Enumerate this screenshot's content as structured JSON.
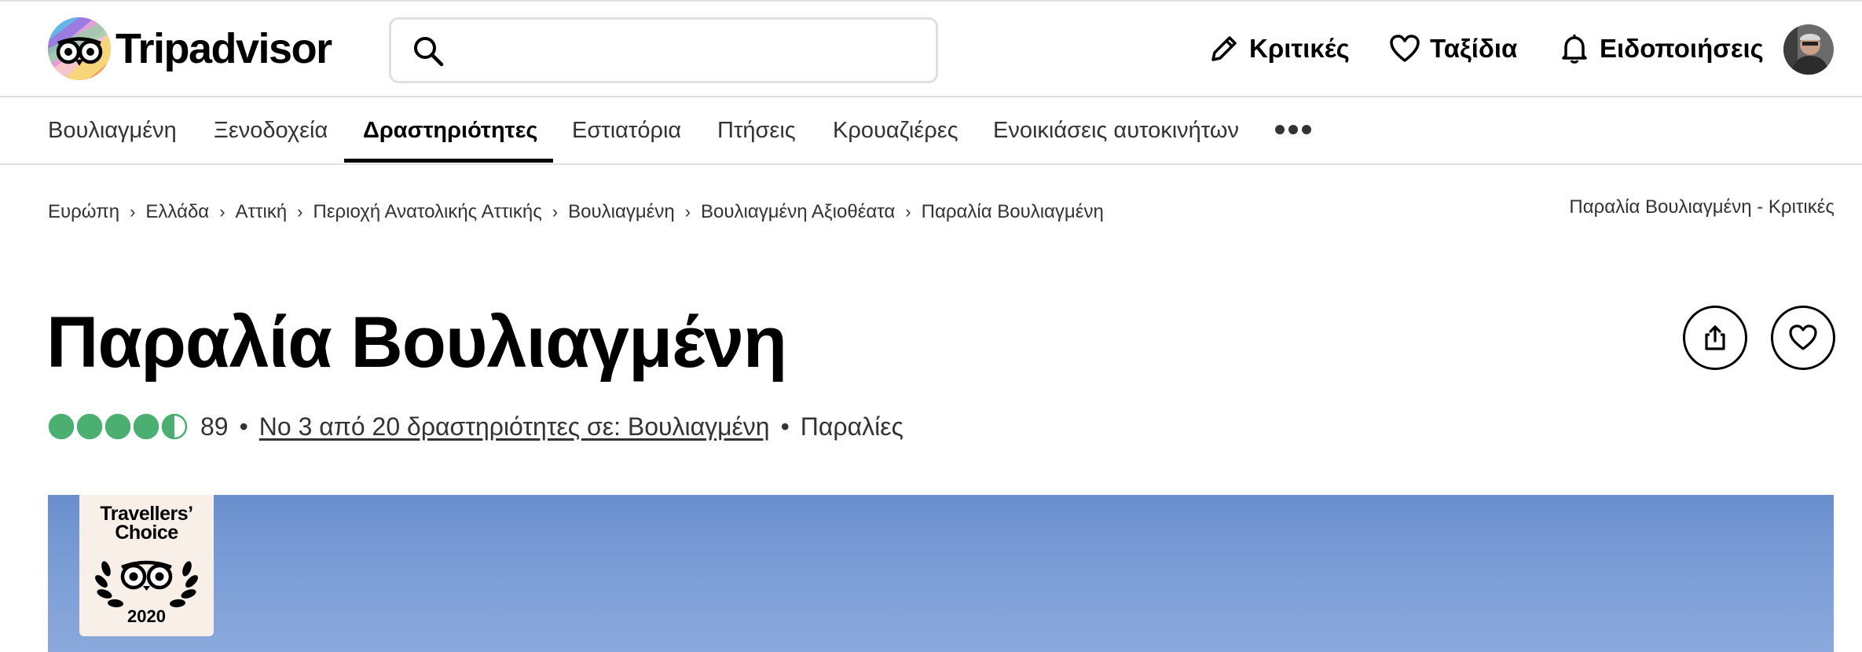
{
  "brand": {
    "name": "Tripadvisor"
  },
  "search": {
    "value": "",
    "placeholder": ""
  },
  "header_nav": [
    {
      "label": "Κριτικές",
      "icon": "pencil-icon"
    },
    {
      "label": "Ταξίδια",
      "icon": "heart-icon"
    },
    {
      "label": "Ειδοποιήσεις",
      "icon": "bell-icon"
    }
  ],
  "subnav": [
    {
      "label": "Βουλιαγμένη",
      "active": false
    },
    {
      "label": "Ξενοδοχεία",
      "active": false
    },
    {
      "label": "Δραστηριότητες",
      "active": true
    },
    {
      "label": "Εστιατόρια",
      "active": false
    },
    {
      "label": "Πτήσεις",
      "active": false
    },
    {
      "label": "Κρουαζιέρες",
      "active": false
    },
    {
      "label": "Ενοικιάσεις αυτοκινήτων",
      "active": false
    }
  ],
  "breadcrumb": [
    "Ευρώπη",
    "Ελλάδα",
    "Αττική",
    "Περιοχή Ανατολικής Αττικής",
    "Βουλιαγμένη",
    "Βουλιαγμένη Αξιοθέατα",
    "Παραλία Βουλιαγμένη"
  ],
  "breadcrumb_right": "Παραλία Βουλιαγμένη - Κριτικές",
  "title": "Παραλία Βουλιαγμένη",
  "rating": {
    "score": 4.5,
    "max": 5,
    "review_count": "89",
    "rank_text": "Νο 3 από 20 δραστηριότητες σε: Βουλιαγμένη",
    "category": "Παραλίες"
  },
  "badge": {
    "line1": "Travellers’",
    "line2": "Choice",
    "year": "2020"
  },
  "colors": {
    "rating_green": "#4caf72",
    "border": "#e0e0e0",
    "sky": "#7b9dd6",
    "badge_bg": "#f8efe9"
  }
}
